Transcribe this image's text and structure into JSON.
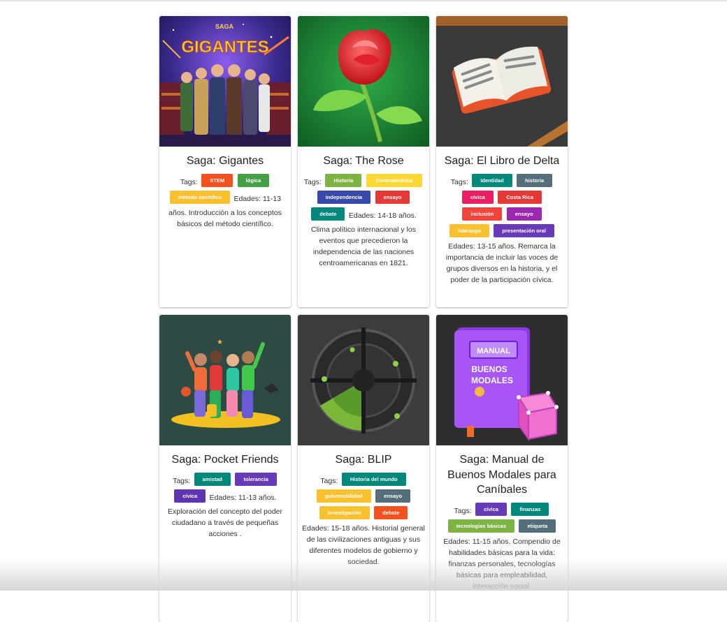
{
  "cards": [
    {
      "title": "Saga: Gigantes",
      "tags_label": "Tags:",
      "tags": [
        {
          "label": "STEM",
          "color": "#f4511e"
        },
        {
          "label": "lógica",
          "color": "#43a047"
        },
        {
          "label": "método científico",
          "color": "#fbc02d"
        }
      ],
      "ages": "Edades: 11-13",
      "description": "años. Introducción a los conceptos básicos del método científico.",
      "art_text": "GIGANTES",
      "art_small": "SAGA"
    },
    {
      "title": "Saga: The Rose",
      "tags_label": "Tags:",
      "tags": [
        {
          "label": "Historia",
          "color": "#7cb342"
        },
        {
          "label": "Centroamérica",
          "color": "#fdd835"
        },
        {
          "label": "independencia",
          "color": "#3949ab"
        },
        {
          "label": "ensayo",
          "color": "#e53935"
        },
        {
          "label": "debate",
          "color": "#00897b"
        }
      ],
      "ages": "Edades: 14-18 años.",
      "description": "Clima político internacional y los eventos que precedieron la independencia de las naciones centroamericanas en 1821."
    },
    {
      "title": "Saga: El Libro de Delta",
      "tags_label": "Tags:",
      "tags": [
        {
          "label": "Identidad",
          "color": "#00897b"
        },
        {
          "label": "historia",
          "color": "#546e7a"
        },
        {
          "label": "cívica",
          "color": "#e91e63"
        },
        {
          "label": "Costa Rica",
          "color": "#e53935"
        },
        {
          "label": "inclusión",
          "color": "#f4433a"
        },
        {
          "label": "ensayo",
          "color": "#9c27b0"
        },
        {
          "label": "liderazgo",
          "color": "#fbc02d"
        },
        {
          "label": "presentación oral",
          "color": "#673ab7"
        }
      ],
      "ages": "Edades: 13-15 años.",
      "description": "Remarca la importancia de incluir las voces de grupos diversos en la historia, y el poder de la participación cívica."
    },
    {
      "title": "Saga: Pocket Friends",
      "tags_label": "Tags:",
      "tags": [
        {
          "label": "amistad",
          "color": "#00897b"
        },
        {
          "label": "tolerancia",
          "color": "#673ab7"
        },
        {
          "label": "cívica",
          "color": "#5e35b1"
        }
      ],
      "ages": "Edades: 11-13 años.",
      "description": "Exploración del concepto del poder ciudadano a través de pequeñas acciones ."
    },
    {
      "title": "Saga: BLIP",
      "tags_label": "Tags:",
      "tags": [
        {
          "label": "Historia del mundo",
          "color": "#00897b"
        },
        {
          "label": "gobernabilidad",
          "color": "#fbc02d"
        },
        {
          "label": "ensayo",
          "color": "#546e7a"
        },
        {
          "label": "investigación",
          "color": "#fbc02d"
        },
        {
          "label": "debate",
          "color": "#f4511e"
        }
      ],
      "ages": "Edades: 15-18 años.",
      "description": "Historial general de las civilizaciones antiguas y sus diferentes modelos de gobierno y sociedad."
    },
    {
      "title": "Saga: Manual de Buenos Modales para Caníbales",
      "tags_label": "Tags:",
      "tags": [
        {
          "label": "cívica",
          "color": "#673ab7"
        },
        {
          "label": "finanzas",
          "color": "#00897b"
        },
        {
          "label": "tecnologías básicas",
          "color": "#7cb342"
        },
        {
          "label": "etiqueta",
          "color": "#546e7a"
        }
      ],
      "ages": "Edades: 11-15 años.",
      "description": "Compendio de habilidades básicas para la vida: finanzas personales, tecnologías básicas para empleabilidad, interacción social.",
      "art_text_1": "MANUAL",
      "art_text_2": "BUENOS",
      "art_text_3": "MODALES"
    }
  ]
}
